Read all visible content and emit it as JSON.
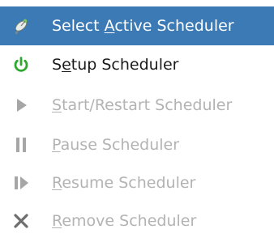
{
  "menu": {
    "items": [
      {
        "label_pre": "Select ",
        "label_mnemonic": "A",
        "label_post": "ctive Scheduler",
        "icon": "satellite-dish-icon",
        "state": "highlighted"
      },
      {
        "label_pre": "S",
        "label_mnemonic": "e",
        "label_post": "tup Scheduler",
        "icon": "power-icon",
        "state": "enabled"
      },
      {
        "label_pre": "",
        "label_mnemonic": "S",
        "label_post": "tart/Restart Scheduler",
        "icon": "play-icon",
        "state": "disabled"
      },
      {
        "label_pre": "",
        "label_mnemonic": "P",
        "label_post": "ause Scheduler",
        "icon": "pause-icon",
        "state": "disabled"
      },
      {
        "label_pre": "",
        "label_mnemonic": "R",
        "label_post": "esume Scheduler",
        "icon": "resume-icon",
        "state": "disabled"
      },
      {
        "label_pre": "",
        "label_mnemonic": "R",
        "label_post": "emove Scheduler",
        "icon": "remove-x-icon",
        "state": "disabled"
      }
    ],
    "colors": {
      "highlight_bg": "#3c7ab5",
      "highlight_text": "#ffffff",
      "enabled_text": "#1a1a1a",
      "disabled_text": "#b3b3b3",
      "power_icon": "#2ea82e",
      "disabled_icon": "#a0a0a0"
    }
  }
}
